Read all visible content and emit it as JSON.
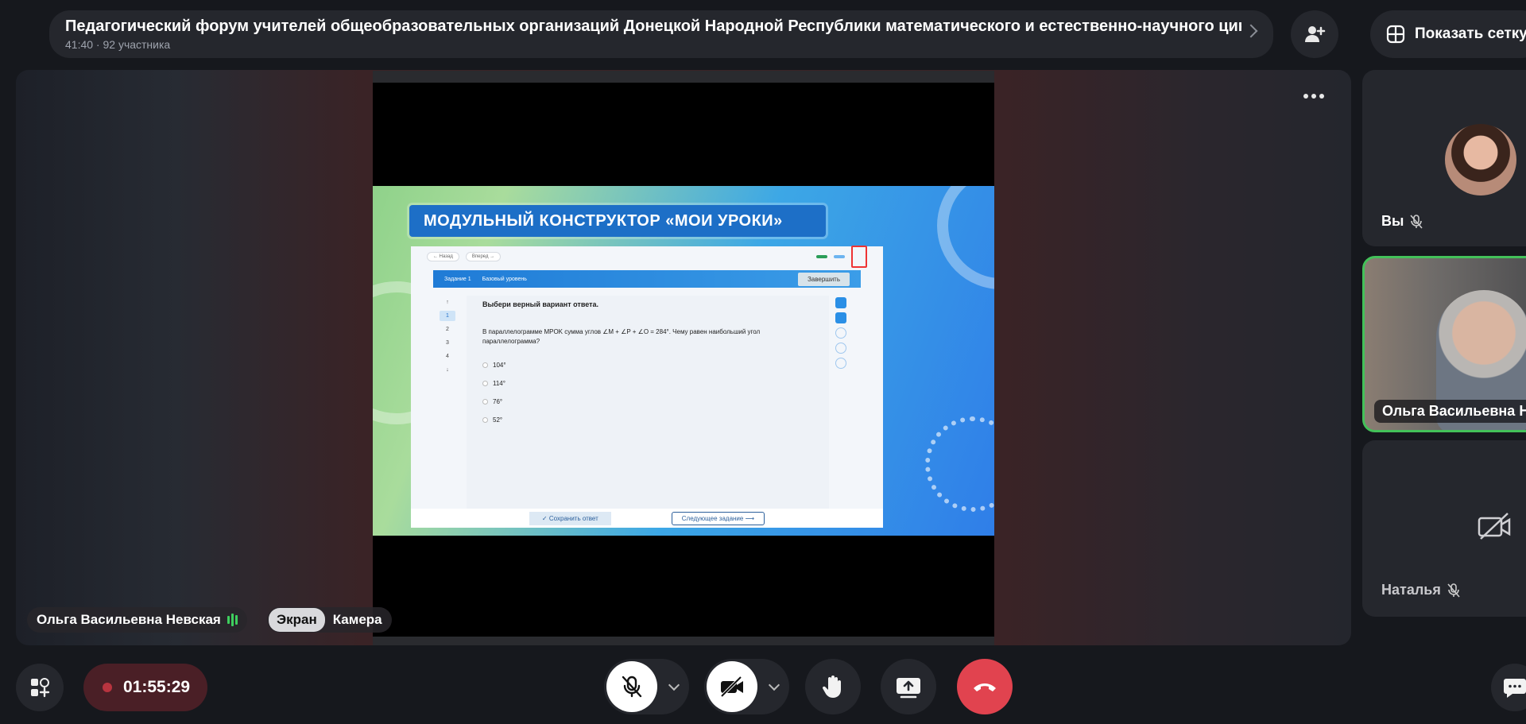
{
  "header": {
    "title": "Педагогический форум учителей общеобразовательных организаций Донецкой Народной Республики математического и естественно-научного цикла",
    "subtitle": "41:40 · 92 участника"
  },
  "toolbar": {
    "grid_label": "Показать сетку"
  },
  "stage": {
    "speaker_name": "Ольга Васильевна Невская",
    "view_options": [
      "Экран",
      "Камера"
    ],
    "selected_view": "Экран"
  },
  "slide": {
    "title": "МОДУЛЬНЫЙ КОНСТРУКТОР «МОИ УРОКИ»",
    "task_label": "Задание 1",
    "level_label": "Базовый уровень",
    "finish_label": "Завершить",
    "question_heading": "Выбери верный вариант ответа.",
    "question_text": "В параллелограмме MPOK сумма углов ∠M + ∠P + ∠O = 284°. Чему равен наибольший угол параллелограмма?",
    "options": [
      "104°",
      "114°",
      "76°",
      "52°"
    ],
    "steps": [
      "1",
      "2",
      "3",
      "4"
    ],
    "save_label": "Сохранить ответ",
    "next_label": "Следующее задание"
  },
  "participants": [
    {
      "name": "Вы",
      "muted": true
    },
    {
      "name": "Ольга Васильевна Н",
      "speaking": true
    },
    {
      "name": "Наталья",
      "muted": true,
      "camera_off": true
    }
  ],
  "controls": {
    "recording_time": "01:55:29",
    "icons": [
      "apps-icon",
      "mic-off-icon",
      "camera-off-icon",
      "raise-hand-icon",
      "share-screen-icon",
      "hangup-icon",
      "chat-icon"
    ]
  },
  "colors": {
    "accent_green": "#43c159",
    "hangup_red": "#e1434f",
    "background": "#16181d",
    "panel": "#25272d"
  }
}
